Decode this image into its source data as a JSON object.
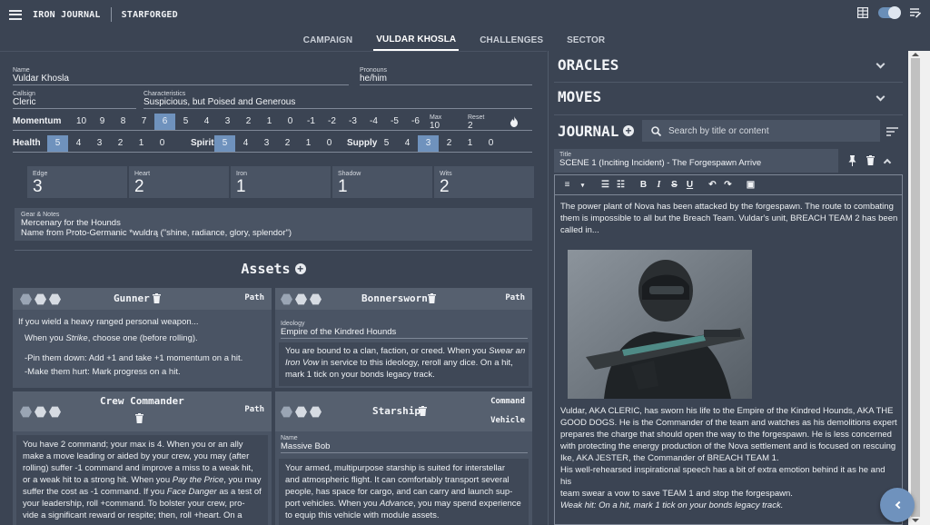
{
  "app": {
    "brand": "IRON JOURNAL",
    "game": "STARFORGED"
  },
  "tabs": [
    {
      "label": "CAMPAIGN",
      "active": false
    },
    {
      "label": "VULDAR KHOSLA",
      "active": true
    },
    {
      "label": "CHALLENGES",
      "active": false
    },
    {
      "label": "SECTOR",
      "active": false
    }
  ],
  "character": {
    "name_label": "Name",
    "name": "Vuldar Khosla",
    "pronouns_label": "Pronouns",
    "pronouns": "he/him",
    "callsign_label": "Callsign",
    "callsign": "Cleric",
    "characteristics_label": "Characteristics",
    "characteristics": "Suspicious, but Poised and Generous"
  },
  "momentum": {
    "label": "Momentum",
    "cells": [
      "10",
      "9",
      "8",
      "7",
      "6",
      "5",
      "4",
      "3",
      "2",
      "1",
      "0",
      "-1",
      "-2",
      "-3",
      "-4",
      "-5",
      "-6"
    ],
    "active_index": 4,
    "max_label": "Max",
    "max": "10",
    "reset_label": "Reset",
    "reset": "2"
  },
  "meters": [
    {
      "label": "Health",
      "cells": [
        "5",
        "4",
        "3",
        "2",
        "1",
        "0"
      ],
      "active_index": 0
    },
    {
      "label": "Spirit",
      "cells": [
        "5",
        "4",
        "3",
        "2",
        "1",
        "0"
      ],
      "active_index": 0
    },
    {
      "label": "Supply",
      "cells": [
        "5",
        "4",
        "3",
        "2",
        "1",
        "0"
      ],
      "active_index": 2
    }
  ],
  "stats": [
    {
      "label": "Edge",
      "value": "3"
    },
    {
      "label": "Heart",
      "value": "2"
    },
    {
      "label": "Iron",
      "value": "1"
    },
    {
      "label": "Shadow",
      "value": "1"
    },
    {
      "label": "Wits",
      "value": "2"
    }
  ],
  "gear": {
    "label": "Gear & Notes",
    "line1": "Mercenary for the Hounds",
    "line2": "Name from Proto-Germanic *wuldrą (\"shine, radiance, glory, splendor\")"
  },
  "assets_title": "Assets",
  "assets": {
    "gunner": {
      "name": "Gunner",
      "type": "Path",
      "intro": "If you wield a heavy ranged personal weapon...",
      "p1a": "When you ",
      "p1b": "Strike",
      "p1c": ", choose one (before rolling).",
      "o1": "-Pin them down: Add +1 and take +1 momentum on a hit.",
      "o2": "-Make them hurt: Mark progress on a hit."
    },
    "bonnersworn": {
      "name": "Bonnersworn",
      "type": "Path",
      "field_label": "Ideology",
      "field_value": "Empire of the Kindred Hounds",
      "l1a": "You are bound to a clan, faction, or creed. When you ",
      "l1b": "Swear an",
      "l2a": "Iron Vow",
      "l2b": " in service to this ideology, reroll any dice. On a hit,",
      "l3": "mark 1 tick on your bonds legacy track."
    },
    "crew": {
      "name": "Crew Commander",
      "type": "Path",
      "l1": "You have 2 command; your max is 4. When you or an ally",
      "l2": "make a move leading or aided by your crew, you may (after",
      "l3": "rolling) suffer -1 command and improve a miss to a weak hit,",
      "l4a": "or a weak hit to a strong hit. When you ",
      "l4b": "Pay the Price",
      "l4c": ", you may",
      "l5a": "suffer the cost as -1 command. If you ",
      "l5b": "Face Danger",
      "l5c": " as a test of",
      "l6": "your leadership, roll +command. To bolster your crew, pro-",
      "l7": "vide a significant reward or respite; then, roll +heart. On a"
    },
    "starship": {
      "name": "Starship",
      "type1": "Command",
      "type2": "Vehicle",
      "field_label": "Name",
      "field_value": "Massive Bob",
      "l1": "Your armed, multipurpose starship is suited for interstellar",
      "l2": "and atmospheric flight. It can comfortably transport several",
      "l3": "people, has space for cargo, and can carry and launch sup-",
      "l4a": "port vehicles. When you ",
      "l4b": "Advance",
      "l4c": ", you may spend experience",
      "l5": "to equip this vehicle with module assets."
    }
  },
  "right": {
    "oracles": "ORACLES",
    "moves": "MOVES",
    "journal": "JOURNAL",
    "search_placeholder": "Search by title or content",
    "entry_title_label": "Title",
    "entry_title": "SCENE 1 (Inciting Incident) - The Forgespawn Arrive",
    "para1a": "The power plant of Nova has been attacked by the forgespawn. The route to combating",
    "para1b": "them is impossible to all but the Breach Team. Vuldar's unit, BREACH TEAM 2 has been",
    "para1c": "called in...",
    "para2a": "Vuldar, AKA CLERIC, has sworn his life to the Empire of the Kindred Hounds, AKA THE",
    "para2b": "GOOD DOGS. He is the Commander of the team and watches as his demolitions expert",
    "para2c": "prepares the charge that should open the way to the forgespawn. He is less concerned",
    "para2d": "with protecting the energy production of the Nova settlement and is focused on rescuing",
    "para2e": "Ike, AKA JESTER, the Commander of BREACH TEAM 1.",
    "para3": "His well-rehearsed inspirational speech has a bit of extra emotion behind it as he and his",
    "para4": "team swear a vow to save TEAM 1 and stop the forgespawn.",
    "para5": "Weak hit: On a hit, mark 1 tick on your bonds legacy track."
  },
  "colors": {
    "background": "#3b4453",
    "panel": "#4a5464",
    "accent": "#6f92bd"
  }
}
